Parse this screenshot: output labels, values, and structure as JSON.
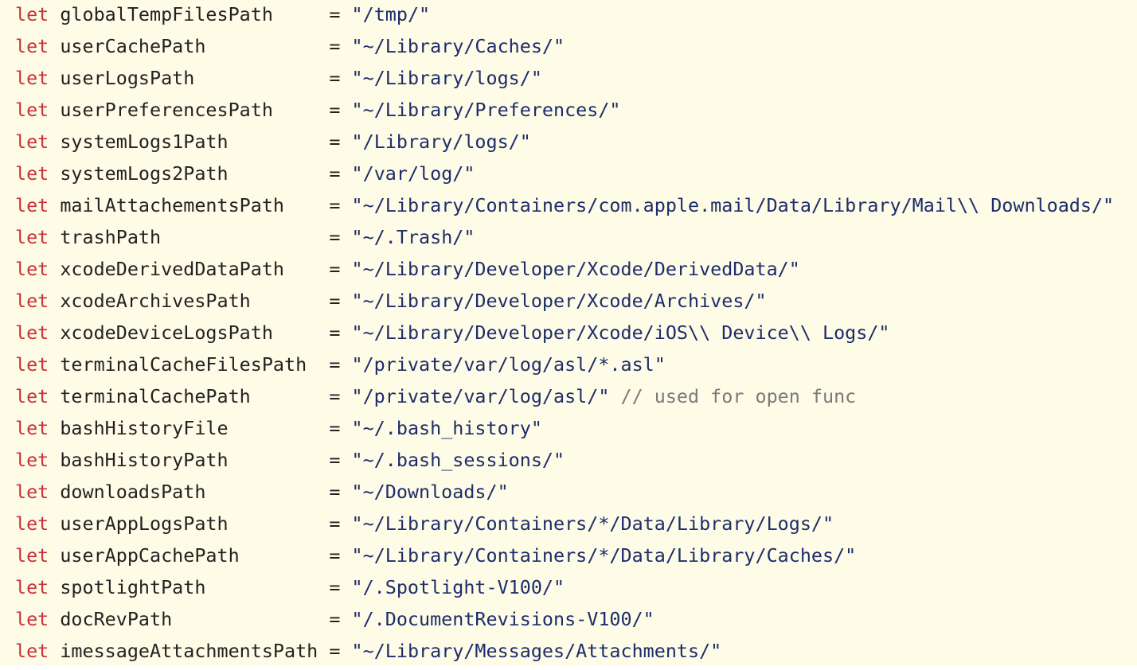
{
  "editor": {
    "colors": {
      "background": "#fefbe6",
      "keyword": "#c8323a",
      "identifier": "#222222",
      "string": "#1c2d6b",
      "comment": "#7a7a7a"
    },
    "lines": [
      {
        "keyword": "let",
        "name": "globalTempFilesPath",
        "pad": "     ",
        "op": "=",
        "value": "\"/tmp/\"",
        "comment": ""
      },
      {
        "keyword": "let",
        "name": "userCachePath",
        "pad": "           ",
        "op": "=",
        "value": "\"~/Library/Caches/\"",
        "comment": ""
      },
      {
        "keyword": "let",
        "name": "userLogsPath",
        "pad": "            ",
        "op": "=",
        "value": "\"~/Library/logs/\"",
        "comment": ""
      },
      {
        "keyword": "let",
        "name": "userPreferencesPath",
        "pad": "     ",
        "op": "=",
        "value": "\"~/Library/Preferences/\"",
        "comment": ""
      },
      {
        "keyword": "let",
        "name": "systemLogs1Path",
        "pad": "         ",
        "op": "=",
        "value": "\"/Library/logs/\"",
        "comment": ""
      },
      {
        "keyword": "let",
        "name": "systemLogs2Path",
        "pad": "         ",
        "op": "=",
        "value": "\"/var/log/\"",
        "comment": ""
      },
      {
        "keyword": "let",
        "name": "mailAttachementsPath",
        "pad": "    ",
        "op": "=",
        "value": "\"~/Library/Containers/com.apple.mail/Data/Library/Mail\\\\ Downloads/\"",
        "comment": ""
      },
      {
        "keyword": "let",
        "name": "trashPath",
        "pad": "               ",
        "op": "=",
        "value": "\"~/.Trash/\"",
        "comment": ""
      },
      {
        "keyword": "let",
        "name": "xcodeDerivedDataPath",
        "pad": "    ",
        "op": "=",
        "value": "\"~/Library/Developer/Xcode/DerivedData/\"",
        "comment": ""
      },
      {
        "keyword": "let",
        "name": "xcodeArchivesPath",
        "pad": "       ",
        "op": "=",
        "value": "\"~/Library/Developer/Xcode/Archives/\"",
        "comment": ""
      },
      {
        "keyword": "let",
        "name": "xcodeDeviceLogsPath",
        "pad": "     ",
        "op": "=",
        "value": "\"~/Library/Developer/Xcode/iOS\\\\ Device\\\\ Logs/\"",
        "comment": ""
      },
      {
        "keyword": "let",
        "name": "terminalCacheFilesPath",
        "pad": "  ",
        "op": "=",
        "value": "\"/private/var/log/asl/*.asl\"",
        "comment": ""
      },
      {
        "keyword": "let",
        "name": "terminalCachePath",
        "pad": "       ",
        "op": "=",
        "value": "\"/private/var/log/asl/\"",
        "comment": "// used for open func"
      },
      {
        "keyword": "let",
        "name": "bashHistoryFile",
        "pad": "         ",
        "op": "=",
        "value": "\"~/.bash_history\"",
        "comment": ""
      },
      {
        "keyword": "let",
        "name": "bashHistoryPath",
        "pad": "         ",
        "op": "=",
        "value": "\"~/.bash_sessions/\"",
        "comment": ""
      },
      {
        "keyword": "let",
        "name": "downloadsPath",
        "pad": "           ",
        "op": "=",
        "value": "\"~/Downloads/\"",
        "comment": ""
      },
      {
        "keyword": "let",
        "name": "userAppLogsPath",
        "pad": "         ",
        "op": "=",
        "value": "\"~/Library/Containers/*/Data/Library/Logs/\"",
        "comment": ""
      },
      {
        "keyword": "let",
        "name": "userAppCachePath",
        "pad": "        ",
        "op": "=",
        "value": "\"~/Library/Containers/*/Data/Library/Caches/\"",
        "comment": ""
      },
      {
        "keyword": "let",
        "name": "spotlightPath",
        "pad": "           ",
        "op": "=",
        "value": "\"/.Spotlight-V100/\"",
        "comment": ""
      },
      {
        "keyword": "let",
        "name": "docRevPath",
        "pad": "              ",
        "op": "=",
        "value": "\"/.DocumentRevisions-V100/\"",
        "comment": ""
      },
      {
        "keyword": "let",
        "name": "imessageAttachmentsPath",
        "pad": " ",
        "op": "=",
        "value": "\"~/Library/Messages/Attachments/\"",
        "comment": ""
      }
    ]
  }
}
